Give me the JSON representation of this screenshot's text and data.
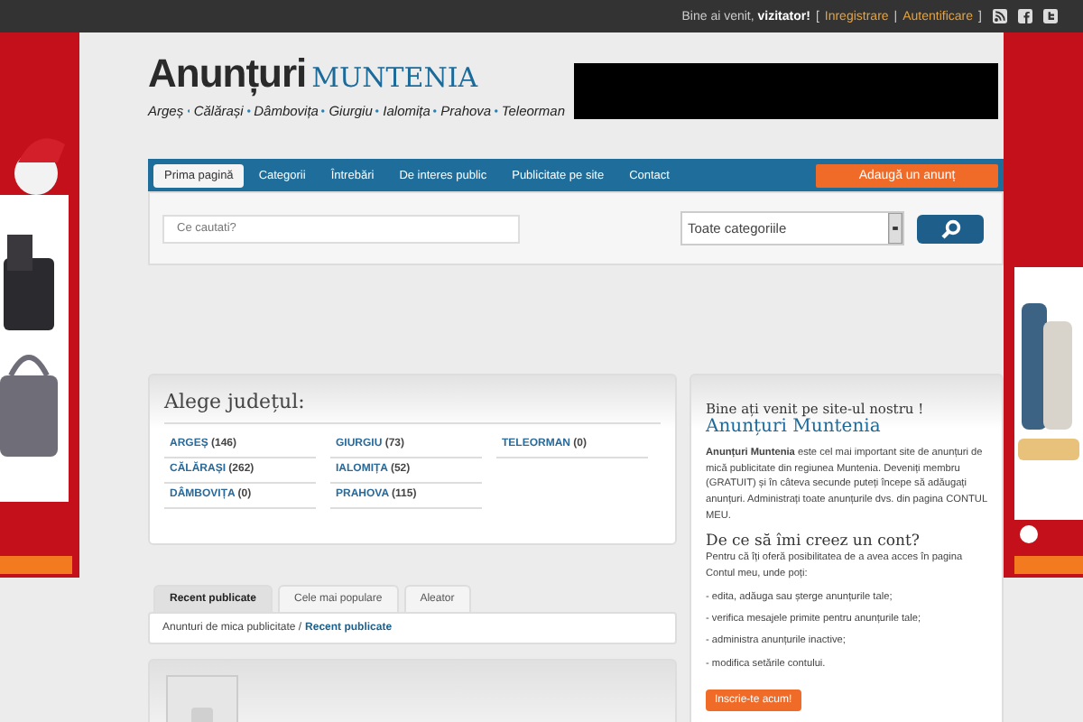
{
  "top_bar": {
    "greeting": "Bine ai venit,",
    "user": "vizitator!",
    "open_bracket": "[",
    "links": [
      {
        "label": "Inregistrare"
      },
      {
        "label": "Autentificare"
      }
    ],
    "separator": "|",
    "close_bracket": "]"
  },
  "logo": {
    "word_1": "Anunțuri",
    "word_2": "MUNTENIA",
    "regions": [
      "Argeș",
      "Călărași",
      "Dâmbovița",
      "Giurgiu",
      "Ialomița",
      "Prahova",
      "Teleorman"
    ]
  },
  "nav": {
    "items": [
      {
        "label": "Prima pagină",
        "selected": true
      },
      {
        "label": "Categorii",
        "selected": false
      },
      {
        "label": "Întrebări",
        "selected": false
      },
      {
        "label": "De interes public",
        "selected": false
      },
      {
        "label": "Publicitate pe site",
        "selected": false
      },
      {
        "label": "Contact",
        "selected": false
      }
    ],
    "add_button": "Adaugă un anunț"
  },
  "search": {
    "placeholder": "Ce cautati?",
    "category": "Toate categoriile"
  },
  "counties": {
    "title": "Alege județul:",
    "items": [
      {
        "name": "ARGEȘ",
        "count": "(146)"
      },
      {
        "name": "GIURGIU",
        "count": "(73)"
      },
      {
        "name": "TELEORMAN",
        "count": "(0)"
      },
      {
        "name": "CĂLĂRAȘI",
        "count": "(262)"
      },
      {
        "name": "IALOMIȚA",
        "count": "(52)"
      },
      {
        "name": "DÂMBOVIȚA",
        "count": "(0)"
      },
      {
        "name": "PRAHOVA",
        "count": "(115)"
      }
    ]
  },
  "tabs": [
    {
      "label": "Recent publicate",
      "selected": true
    },
    {
      "label": "Cele mai populare",
      "selected": false
    },
    {
      "label": "Aleator",
      "selected": false
    }
  ],
  "breadcrumb": {
    "root": "Anunturi de mica publicitate /",
    "current": "Recent publicate"
  },
  "welcome": {
    "heading": "Bine ați venit pe site-ul nostru !",
    "site_name": "Anunțuri Muntenia",
    "intro": "**Anunțuri Muntenia** este cel mai important site de anunțuri de mică publicitate din regiunea Muntenia. Deveniți membru (GRATUIT) și în câteva secunde puteți începe să adăugați anunțuri. Administrați toate anunțurile dvs. din pagina CONTUL MEU.",
    "question": "De ce să îmi creez un cont?",
    "lead": "Pentru că îți oferă posibilitatea de a avea acces în pagina Contul meu, unde poți:",
    "benefits": [
      "- edita, adăuga sau șterge anunțurile tale;",
      "- verifica mesajele primite pentru anunțurile tale;",
      "- administra anunțurile inactive;",
      "- modifica setările contului."
    ],
    "signup_button": "Inscrie-te acum!"
  }
}
